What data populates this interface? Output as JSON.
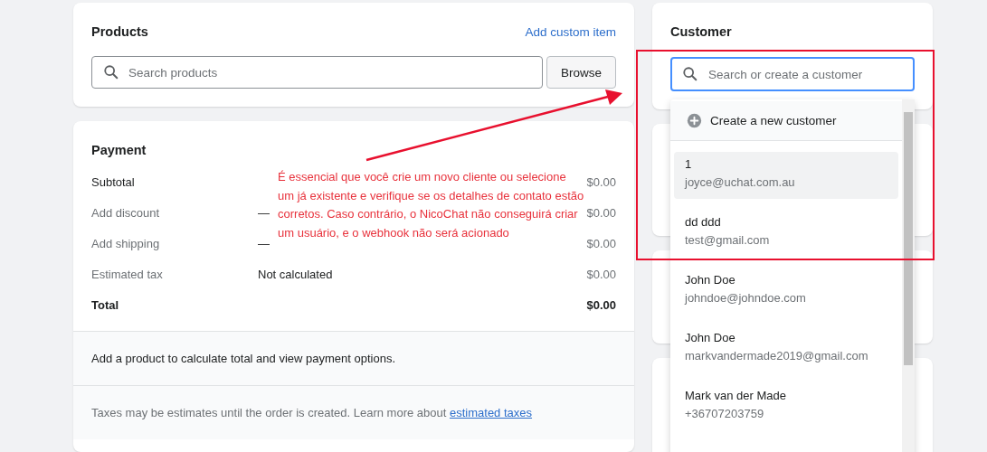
{
  "products": {
    "title": "Products",
    "add_link": "Add custom item",
    "search": {
      "placeholder": "Search products"
    },
    "browse_button": "Browse"
  },
  "payment": {
    "title": "Payment",
    "rows": [
      {
        "kind": "line",
        "label": "Subtotal",
        "detail": "",
        "amount": "$0.00"
      },
      {
        "kind": "action",
        "label": "Add discount",
        "detail": "—",
        "amount": "$0.00"
      },
      {
        "kind": "action",
        "label": "Add shipping",
        "detail": "—",
        "amount": "$0.00"
      },
      {
        "kind": "action",
        "label": "Estimated tax",
        "detail": "Not calculated",
        "amount": "$0.00"
      },
      {
        "kind": "total",
        "label": "Total",
        "detail": "",
        "amount": "$0.00"
      }
    ],
    "notice": "Add a product to calculate total and view payment options.",
    "footer_text": "Taxes may be estimates until the order is created. Learn more about",
    "footer_link": "estimated taxes"
  },
  "customer": {
    "title": "Customer",
    "search": {
      "placeholder": "Search or create a customer"
    },
    "dropdown": {
      "create_option": "Create a new customer",
      "results": [
        {
          "name": "1",
          "detail": "joyce@uchat.com.au",
          "selected": true
        },
        {
          "name": "dd ddd",
          "detail": "test@gmail.com",
          "selected": false
        },
        {
          "name": "John Doe",
          "detail": "johndoe@johndoe.com",
          "selected": false
        },
        {
          "name": "John Doe",
          "detail": "markvandermade2019@gmail.com",
          "selected": false
        },
        {
          "name": "Mark van der Made",
          "detail": "+36707203759",
          "selected": false
        }
      ]
    }
  },
  "annotation": {
    "text": "É essencial que você crie um novo cliente ou selecione um já existente e verifique se os detalhes de contato estão corretos. Caso contrário, o NicoChat não conseguirá criar um usuário, e o webhook não será acionado"
  }
}
